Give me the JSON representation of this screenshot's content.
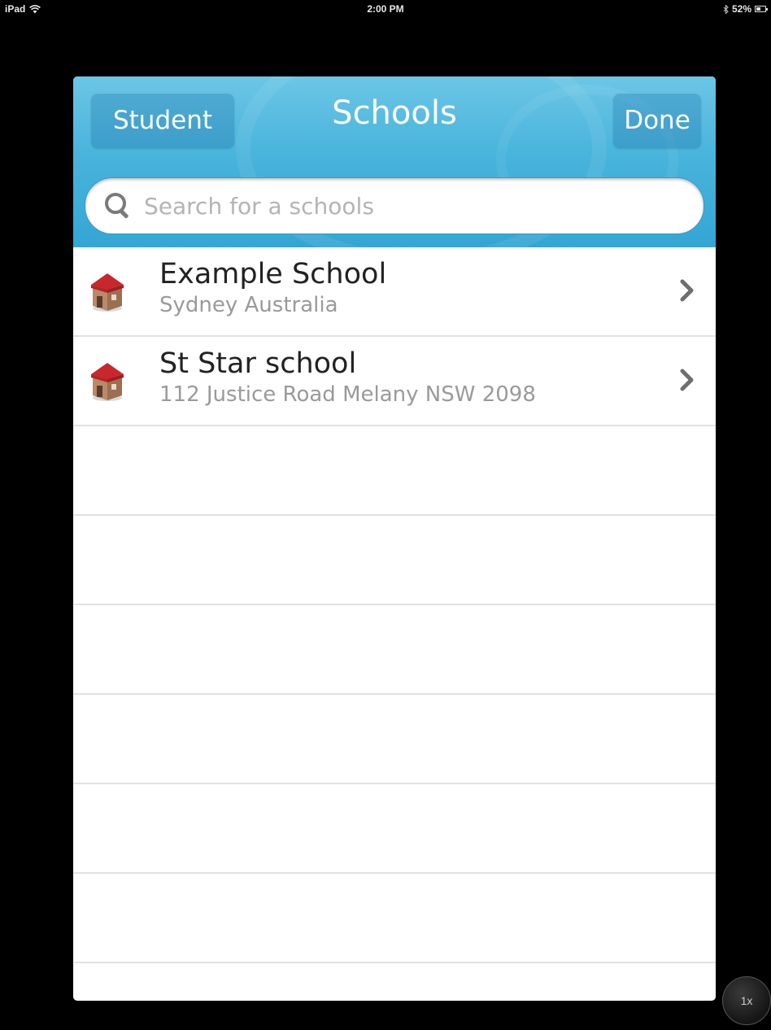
{
  "status_bar": {
    "device": "iPad",
    "time": "2:00 PM",
    "battery": "52%",
    "battery_level": 0.52
  },
  "nav": {
    "back_label": "Student",
    "title": "Schools",
    "done_label": "Done"
  },
  "search": {
    "placeholder": "Search for a schools",
    "value": ""
  },
  "schools": [
    {
      "name": "Example School",
      "address": "Sydney Australia"
    },
    {
      "name": "St Star school",
      "address": "112 Justice Road  Melany NSW 2098"
    }
  ],
  "colors": {
    "header": "#49b4dc",
    "row_divider": "#e2e2e2",
    "icon_roof": "#c8282d",
    "icon_wall": "#b98a6a"
  },
  "zoom": {
    "label": "1x"
  }
}
